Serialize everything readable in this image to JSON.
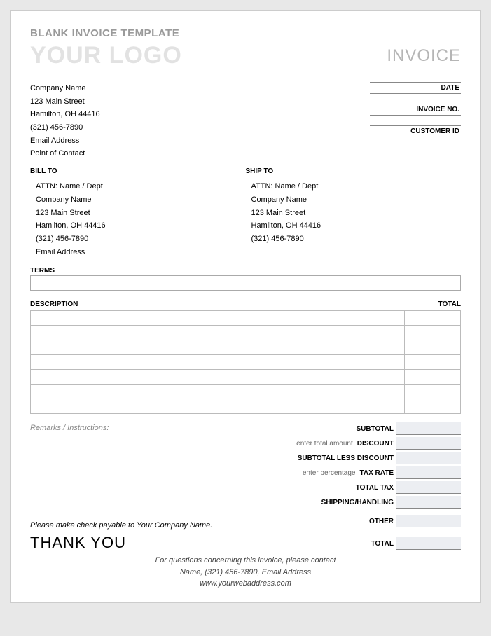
{
  "template_title": "BLANK INVOICE TEMPLATE",
  "logo_text": "YOUR LOGO",
  "invoice_word": "INVOICE",
  "company": {
    "name": "Company Name",
    "street": "123 Main Street",
    "citystate": "Hamilton, OH 44416",
    "phone": "(321) 456-7890",
    "email": "Email Address",
    "contact": "Point of Contact"
  },
  "meta": {
    "date_label": "DATE",
    "invoice_no_label": "INVOICE NO.",
    "customer_id_label": "CUSTOMER ID"
  },
  "bill_to": {
    "label": "BILL TO",
    "attn": "ATTN: Name / Dept",
    "company": "Company Name",
    "street": "123 Main Street",
    "citystate": "Hamilton, OH 44416",
    "phone": "(321) 456-7890",
    "email": "Email Address"
  },
  "ship_to": {
    "label": "SHIP TO",
    "attn": "ATTN: Name / Dept",
    "company": "Company Name",
    "street": "123 Main Street",
    "citystate": "Hamilton, OH 44416",
    "phone": "(321) 456-7890"
  },
  "terms_label": "TERMS",
  "columns": {
    "description": "DESCRIPTION",
    "total": "TOTAL"
  },
  "remarks_label": "Remarks / Instructions:",
  "totals": {
    "subtotal": "SUBTOTAL",
    "discount": "DISCOUNT",
    "discount_hint": "enter total amount",
    "subtotal_less": "SUBTOTAL LESS DISCOUNT",
    "tax_rate": "TAX RATE",
    "tax_rate_hint": "enter percentage",
    "total_tax": "TOTAL TAX",
    "shipping": "SHIPPING/HANDLING",
    "other": "OTHER",
    "total": "TOTAL"
  },
  "payable": "Please make check payable to Your Company Name.",
  "thanks": "THANK YOU",
  "footer": {
    "line1": "For questions concerning this invoice, please contact",
    "line2": "Name, (321) 456-7890, Email Address",
    "line3": "www.yourwebaddress.com"
  }
}
